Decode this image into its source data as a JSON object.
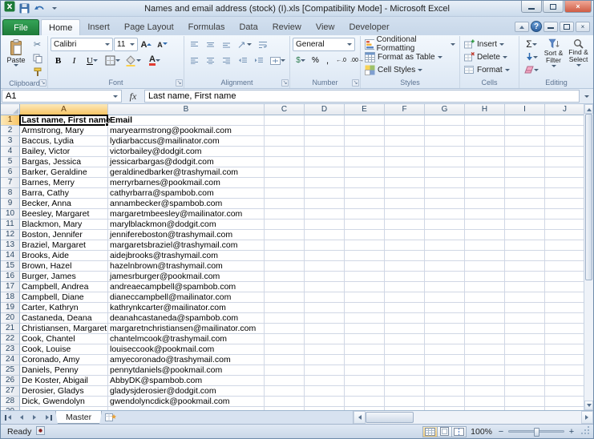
{
  "window": {
    "title": "Names and email address (stock) (I).xls  [Compatibility Mode] -  Microsoft Excel"
  },
  "colors": {
    "file_tab_green": "#1d7a38",
    "selected_header_amber": "#f8c565",
    "selection_border": "#000000",
    "gridline": "#d0d7e5"
  },
  "ribbon": {
    "file_tab": "File",
    "tabs": [
      "Home",
      "Insert",
      "Page Layout",
      "Formulas",
      "Data",
      "Review",
      "View",
      "Developer"
    ],
    "active_tab": "Home",
    "clipboard": {
      "label": "Clipboard",
      "paste": "Paste"
    },
    "font": {
      "label": "Font",
      "name": "Calibri",
      "size": "11",
      "bold": "B",
      "italic": "I",
      "underline": "U"
    },
    "alignment": {
      "label": "Alignment"
    },
    "number": {
      "label": "Number",
      "format": "General",
      "accounting": "$",
      "percent": "%",
      "comma": ",",
      "inc_decimal": "←.0",
      "dec_decimal": ".00→"
    },
    "styles": {
      "label": "Styles",
      "items": [
        "Conditional Formatting",
        "Format as Table",
        "Cell Styles"
      ]
    },
    "cells": {
      "label": "Cells",
      "items": [
        "Insert",
        "Delete",
        "Format"
      ]
    },
    "editing": {
      "label": "Editing",
      "autosum": "Σ",
      "sort_filter": "Sort & Filter",
      "find_select": "Find & Select"
    }
  },
  "formula_bar": {
    "name_box": "A1",
    "fx": "fx",
    "value": "Last name, First name"
  },
  "grid": {
    "selected_cell": "A1",
    "columns": [
      "A",
      "B",
      "C",
      "D",
      "E",
      "F",
      "G",
      "H",
      "I",
      "J"
    ],
    "rows": [
      [
        "Last name, First name",
        "Email"
      ],
      [
        "Armstrong, Mary",
        "maryearmstrong@pookmail.com"
      ],
      [
        "Baccus, Lydia",
        "lydiarbaccus@mailinator.com"
      ],
      [
        "Bailey, Victor",
        "victorbailey@dodgit.com"
      ],
      [
        "Bargas, Jessica",
        "jessicarbargas@dodgit.com"
      ],
      [
        "Barker, Geraldine",
        "geraldinedbarker@trashymail.com"
      ],
      [
        "Barnes, Merry",
        "merryrbarnes@pookmail.com"
      ],
      [
        "Barra, Cathy",
        "cathyrbarra@spambob.com"
      ],
      [
        "Becker, Anna",
        "annambecker@spambob.com"
      ],
      [
        "Beesley, Margaret",
        "margaretmbeesley@mailinator.com"
      ],
      [
        "Blackmon, Mary",
        "marylblackmon@dodgit.com"
      ],
      [
        "Boston, Jennifer",
        "jennifereboston@trashymail.com"
      ],
      [
        "Braziel, Margaret",
        "margaretsbraziel@trashymail.com"
      ],
      [
        "Brooks, Aide",
        "aidejbrooks@trashymail.com"
      ],
      [
        "Brown, Hazel",
        "hazelnbrown@trashymail.com"
      ],
      [
        "Burger, James",
        "jamesrburger@pookmail.com"
      ],
      [
        "Campbell, Andrea",
        "andreaecampbell@spambob.com"
      ],
      [
        "Campbell, Diane",
        "dianeccampbell@mailinator.com"
      ],
      [
        "Carter, Kathryn",
        "kathrynkcarter@mailinator.com"
      ],
      [
        "Castaneda, Deana",
        "deanahcastaneda@spambob.com"
      ],
      [
        "Christiansen, Margaret",
        "margaretnchristiansen@mailinator.com"
      ],
      [
        "Cook, Chantel",
        "chantelmcook@trashymail.com"
      ],
      [
        "Cook, Louise",
        "louiseccook@pookmail.com"
      ],
      [
        "Coronado, Amy",
        "amyecoronado@trashymail.com"
      ],
      [
        "Daniels, Penny",
        "pennytdaniels@pookmail.com"
      ],
      [
        "De Koster, Abigail",
        "AbbyDK@spambob.com"
      ],
      [
        "Derosier, Gladys",
        "gladysjderosier@dodgit.com"
      ],
      [
        "Dick, Gwendolyn",
        "gwendolyncdick@pookmail.com"
      ]
    ]
  },
  "sheet_bar": {
    "tabs": [
      "Master"
    ],
    "active_tab": "Master"
  },
  "status_bar": {
    "mode": "Ready",
    "zoom": "100%"
  }
}
